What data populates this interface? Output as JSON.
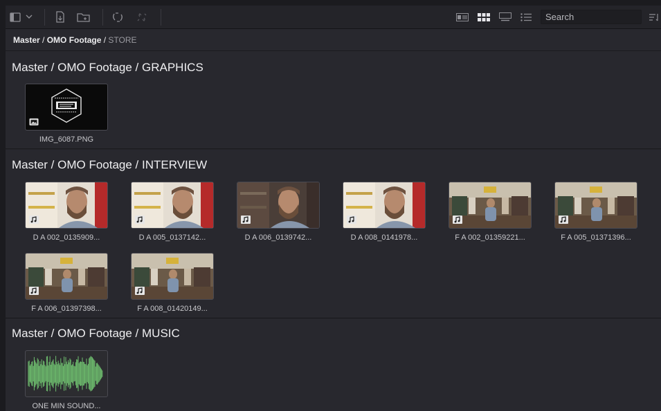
{
  "toolbar": {
    "search_placeholder": "Search",
    "icons": [
      "panel-toggle-icon",
      "chevron-down-icon",
      "import-media-icon",
      "new-bin-icon",
      "relink-icon",
      "unlink-icon",
      "metadata-view-icon",
      "thumbnail-view-icon",
      "filmstrip-view-icon",
      "list-view-icon",
      "sort-icon"
    ]
  },
  "breadcrumb": {
    "parts": [
      "Master",
      "OMO Footage"
    ],
    "separator": " / ",
    "current": "STORE"
  },
  "sections": [
    {
      "title": "Master / OMO Footage / GRAPHICS",
      "clips": [
        {
          "name": "IMG_6087.PNG",
          "type": "image"
        }
      ]
    },
    {
      "title": "Master / OMO Footage / INTERVIEW",
      "clips": [
        {
          "name": "D A 002_0135909...",
          "type": "video",
          "scene": "closeup"
        },
        {
          "name": "D A 005_0137142...",
          "type": "video",
          "scene": "closeup"
        },
        {
          "name": "D A 006_0139742...",
          "type": "video",
          "scene": "closeup-dark"
        },
        {
          "name": "D A 008_0141978...",
          "type": "video",
          "scene": "closeup"
        },
        {
          "name": "F A 002_01359221...",
          "type": "video",
          "scene": "wide"
        },
        {
          "name": "F A 005_01371396...",
          "type": "video",
          "scene": "wide"
        },
        {
          "name": "F A 006_01397398...",
          "type": "video",
          "scene": "wide"
        },
        {
          "name": "F A 008_01420149...",
          "type": "video",
          "scene": "wide"
        }
      ]
    },
    {
      "title": "Master / OMO Footage / MUSIC",
      "clips": [
        {
          "name": "ONE MIN SOUND...",
          "type": "audio"
        }
      ]
    }
  ],
  "colors": {
    "background": "#28282e",
    "waveform": "#6fbf6f",
    "toolbar": "#242429"
  }
}
